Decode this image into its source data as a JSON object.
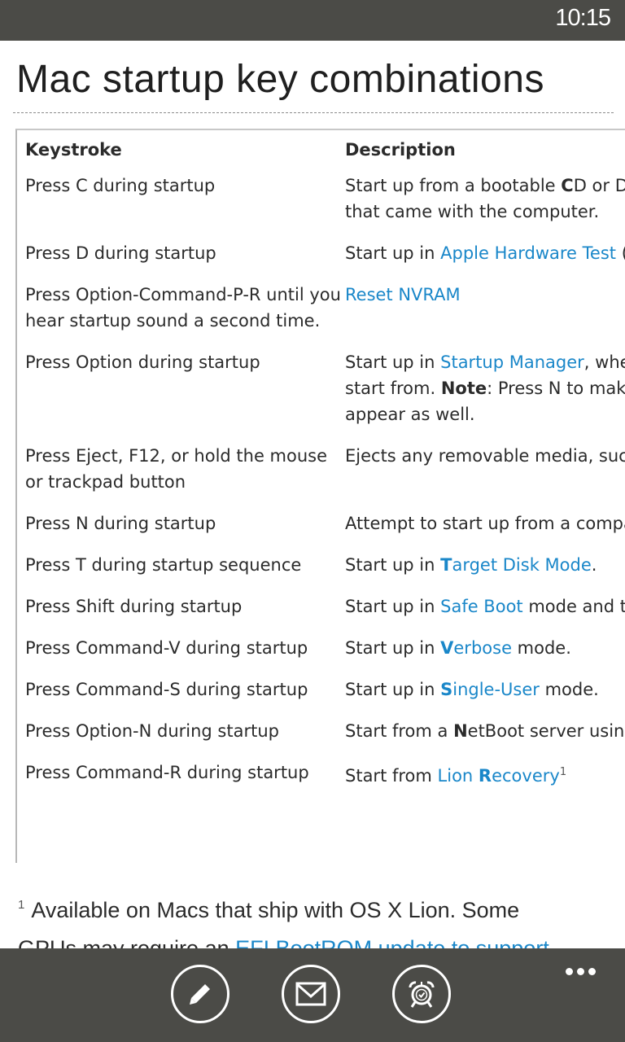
{
  "status_bar": {
    "time": "10:15"
  },
  "page": {
    "title": "Mac startup key combinations",
    "table": {
      "headers": [
        "Keystroke",
        "Description"
      ],
      "rows": [
        {
          "key": "Press C during startup",
          "desc": [
            {
              "t": "Start up from a bootable "
            },
            {
              "t": "C",
              "b": true
            },
            {
              "t": "D or DVD, such as the OS X Install disc"
            },
            {
              "t": " that came with the computer.",
              "br": true
            }
          ]
        },
        {
          "key": "Press D during startup",
          "desc": [
            {
              "t": "Start up in "
            },
            {
              "t": "Apple Hardware Test",
              "link": true
            },
            {
              "t": " (AHT), if the disc is in the drive."
            }
          ]
        },
        {
          "key": "Press Option-Command-P-R until you hear startup sound a second time.",
          "desc": [
            {
              "t": "Reset NVRAM",
              "link": true
            }
          ]
        },
        {
          "key": "Press Option during startup",
          "desc": [
            {
              "t": "Start up in "
            },
            {
              "t": "Startup Manager",
              "link": true
            },
            {
              "t": ", where you can select an OS X volume to"
            },
            {
              "t": "start from. ",
              "br": true
            },
            {
              "t": "Note",
              "b": true
            },
            {
              "t": ": Press N to make the first bootable Network volume"
            },
            {
              "t": "appear as well.",
              "br": true
            }
          ]
        },
        {
          "key": "Press Eject, F12, or hold the mouse or trackpad button",
          "desc": [
            {
              "t": "Ejects any removable media, such as an optical disc."
            }
          ]
        },
        {
          "key": "Press N during startup",
          "desc": [
            {
              "t": "Attempt to start up from a compatible network server (NetBoot)."
            }
          ]
        },
        {
          "key": "Press T during startup sequence",
          "desc": [
            {
              "t": "Start up in "
            },
            {
              "t": "T",
              "b": true,
              "link": true
            },
            {
              "t": "arget Disk Mode",
              "link": true
            },
            {
              "t": "."
            }
          ]
        },
        {
          "key": "Press Shift during startup",
          "desc": [
            {
              "t": "Start up in "
            },
            {
              "t": "Safe Boot",
              "link": true
            },
            {
              "t": " mode and temporarily disable login items."
            }
          ]
        },
        {
          "key": "Press Command-V during startup",
          "desc": [
            {
              "t": "Start up in "
            },
            {
              "t": "V",
              "b": true,
              "link": true
            },
            {
              "t": "erbose",
              "link": true
            },
            {
              "t": " mode."
            }
          ]
        },
        {
          "key": "Press Command-S during startup",
          "desc": [
            {
              "t": "Start up in "
            },
            {
              "t": "S",
              "b": true,
              "link": true
            },
            {
              "t": "ingle-User",
              "link": true
            },
            {
              "t": " mode."
            }
          ]
        },
        {
          "key": "Press Option-N during startup",
          "desc": [
            {
              "t": "Start from a "
            },
            {
              "t": "N",
              "b": true
            },
            {
              "t": "etBoot server using the default boot image."
            }
          ]
        },
        {
          "key": "Press Command-R during startup",
          "desc": [
            {
              "t": "Start from "
            },
            {
              "t": "Lion ",
              "link": true
            },
            {
              "t": "R",
              "b": true,
              "link": true
            },
            {
              "t": "ecovery",
              "link": true
            },
            {
              "t": "1",
              "sup": true
            }
          ]
        }
      ]
    },
    "footnote": {
      "mark": "1",
      "text": "Available on Macs that ship with OS X Lion. Some",
      "line2_prefix": "GPUs may require an ",
      "line2_link": "EFI BootROM update to support"
    }
  },
  "app_bar": {
    "buttons": [
      {
        "name": "edit",
        "icon": "pencil-icon"
      },
      {
        "name": "share-email",
        "icon": "mail-icon"
      },
      {
        "name": "reminder",
        "icon": "alarm-clock-icon"
      }
    ],
    "more_icon": "ellipsis-icon"
  },
  "colors": {
    "chrome": "#4b4b47",
    "link": "#1a87c9",
    "text": "#2b2b2b"
  }
}
